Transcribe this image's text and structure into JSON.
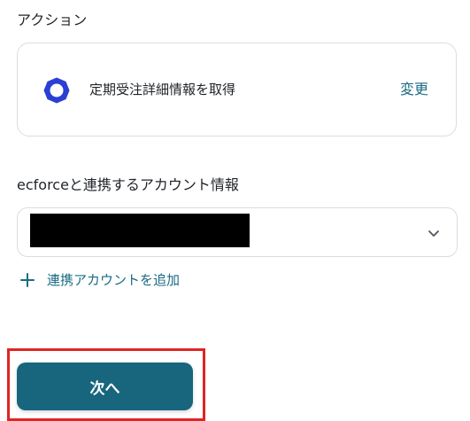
{
  "action_section": {
    "label": "アクション",
    "action_name": "定期受注詳細情報を取得",
    "change_label": "変更",
    "icon": "ecforce-ring-icon"
  },
  "account_section": {
    "label": "ecforceと連携するアカウント情報",
    "selected_value_redacted": true,
    "add_account_label": "連携アカウントを追加"
  },
  "footer": {
    "next_label": "次へ"
  },
  "colors": {
    "accent": "#1a6b84",
    "button": "#17667e",
    "icon_blue": "#2a3fd4",
    "highlight": "#e02424",
    "border": "#d9dde2"
  }
}
